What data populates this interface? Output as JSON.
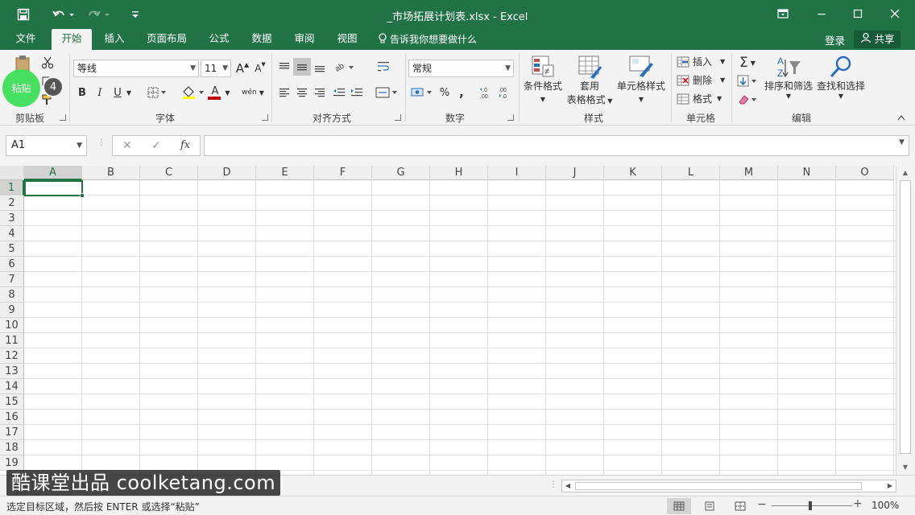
{
  "window": {
    "title": "_市场拓展计划表.xlsx  -  Excel",
    "accent_color": "#217346"
  },
  "quick_access": {
    "save_icon": "save-icon",
    "undo_icon": "undo-icon",
    "redo_icon": "redo-icon",
    "customize_icon": "customize-qat-icon"
  },
  "tabs": [
    "文件",
    "开始",
    "插入",
    "页面布局",
    "公式",
    "数据",
    "审阅",
    "视图"
  ],
  "active_tab": "开始",
  "tell_me": "告诉我你想要做什么",
  "login": "登录",
  "share": "共享",
  "ribbon": {
    "clipboard": {
      "paste": "粘贴",
      "label": "剪贴板",
      "step_badge": "4"
    },
    "font": {
      "font_name": "等线",
      "font_size": "11",
      "bold": "B",
      "italic": "I",
      "underline": "U",
      "grow": "A",
      "shrink": "A",
      "font_color_letter": "A",
      "phonetic": "wén",
      "label": "字体"
    },
    "alignment": {
      "label": "对齐方式"
    },
    "number": {
      "format": "常规",
      "percent": "%",
      "comma": ",",
      "label": "数字"
    },
    "styles": {
      "conditional": "条件格式",
      "table_top": "套用",
      "table_bottom": "表格格式",
      "cell_styles": "单元格样式",
      "label": "样式"
    },
    "cells": {
      "insert": "插入",
      "delete": "删除",
      "format": "格式",
      "label": "单元格"
    },
    "editing": {
      "sort": "排序和筛选",
      "find": "查找和选择",
      "label": "编辑"
    }
  },
  "formula_bar": {
    "name_box": "A1",
    "cancel": "✕",
    "enter": "✓",
    "fx": "fx",
    "value": ""
  },
  "grid": {
    "columns": [
      "A",
      "B",
      "C",
      "D",
      "E",
      "F",
      "G",
      "H",
      "I",
      "J",
      "K",
      "L",
      "M",
      "N",
      "O"
    ],
    "rows": [
      "1",
      "2",
      "3",
      "4",
      "5",
      "6",
      "7",
      "8",
      "9",
      "10",
      "11",
      "12",
      "13",
      "14",
      "15",
      "16",
      "17",
      "18",
      "19"
    ],
    "selected_cell": "A1"
  },
  "watermark": "酷课堂出品 coolketang.com",
  "statusbar": {
    "message": "选定目标区域，然后按 ENTER 或选择“粘贴”",
    "zoom": "100%",
    "zoom_minus": "−",
    "zoom_plus": "+"
  }
}
